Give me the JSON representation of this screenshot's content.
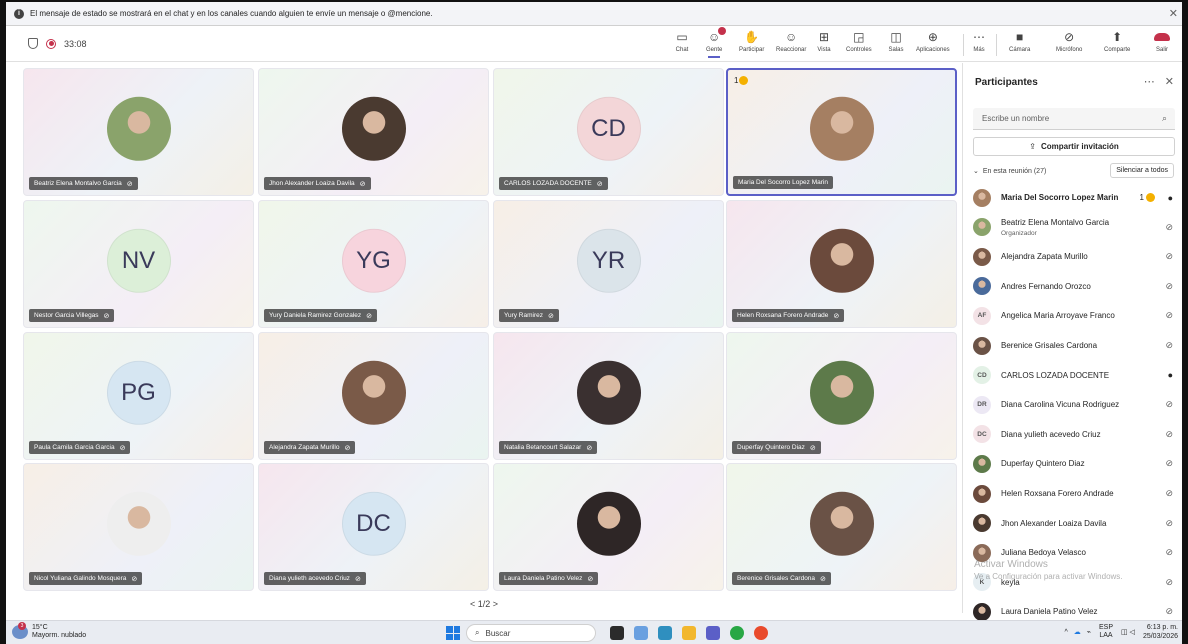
{
  "banner": {
    "text": "El mensaje de estado se mostrará en el chat y en los canales cuando alguien te envíe un mensaje o @mencione."
  },
  "meeting": {
    "elapsed": "33:08"
  },
  "toolbar": {
    "items": [
      {
        "label": "Chat",
        "icon": "chat-icon"
      },
      {
        "label": "Gente",
        "icon": "people-icon"
      },
      {
        "label": "Participar",
        "icon": "hand-icon"
      },
      {
        "label": "Reaccionar",
        "icon": "emoji-icon"
      },
      {
        "label": "Vista",
        "icon": "grid-icon"
      },
      {
        "label": "Controles",
        "icon": "controls-icon"
      },
      {
        "label": "Salas",
        "icon": "rooms-icon"
      },
      {
        "label": "Aplicaciones",
        "icon": "apps-icon"
      },
      {
        "label": "Más",
        "icon": "more-icon"
      },
      {
        "label": "Cámara",
        "icon": "camera-off-icon"
      },
      {
        "label": "Micrófono",
        "icon": "mic-off-icon"
      },
      {
        "label": "Comparte",
        "icon": "share-icon"
      },
      {
        "label": "Salir",
        "icon": "leave-icon"
      }
    ]
  },
  "grid": {
    "tiles": [
      {
        "name": "Beatriz Elena Montalvo Garcia",
        "initials": "",
        "photo": "#8aa36b"
      },
      {
        "name": "Jhon Alexander Loaiza Davila",
        "initials": "",
        "photo": "#4a3a30"
      },
      {
        "name": "CARLOS LOZADA DOCENTE",
        "initials": "CD",
        "photo": ""
      },
      {
        "name": "Maria Del Socorro Lopez Marin",
        "initials": "",
        "photo": "#a57f62",
        "hand": "1"
      },
      {
        "name": "Nestor Garcia Villegas",
        "initials": "NV",
        "photo": ""
      },
      {
        "name": "Yury Daniela Ramirez Gonzalez",
        "initials": "YG",
        "photo": ""
      },
      {
        "name": "Yury Ramirez",
        "initials": "YR",
        "photo": ""
      },
      {
        "name": "Helen Roxsana Forero Andrade",
        "initials": "",
        "photo": "#6b4a3c"
      },
      {
        "name": "Paula Camila Garcia Garcia",
        "initials": "PG",
        "photo": ""
      },
      {
        "name": "Alejandra Zapata Murillo",
        "initials": "",
        "photo": "#7a5a48"
      },
      {
        "name": "Natalia Betancourt Salazar",
        "initials": "",
        "photo": "#3a3030"
      },
      {
        "name": "Duperfay Quintero Diaz",
        "initials": "",
        "photo": "#5d7a4a"
      },
      {
        "name": "Nicol Yuliana Galindo Mosquera",
        "initials": "",
        "photo": "#eeeeee"
      },
      {
        "name": "Diana yulieth acevedo Criuz",
        "initials": "DC",
        "photo": ""
      },
      {
        "name": "Laura Daniela Patino Velez",
        "initials": "",
        "photo": "#2e2626"
      },
      {
        "name": "Berenice Grisales Cardona",
        "initials": "",
        "photo": "#6a5246"
      }
    ],
    "pager": "< 1/2 >"
  },
  "participants": {
    "title": "Participantes",
    "search_placeholder": "Escribe un nombre",
    "share_label": "Compartir invitación",
    "section_label": "En esta reunión (27)",
    "mute_all_label": "Silenciar a todos",
    "list": [
      {
        "name": "Maria Del Socorro Lopez Marin",
        "role": "",
        "initials": "",
        "photo": "#a57f62",
        "hand": "1",
        "mic": "on",
        "bold": true
      },
      {
        "name": "Beatriz Elena Montalvo Garcia",
        "role": "Organizador",
        "initials": "",
        "photo": "#8aa36b",
        "mic": "off"
      },
      {
        "name": "Alejandra Zapata Murillo",
        "role": "",
        "initials": "",
        "photo": "#7a5a48",
        "mic": "off"
      },
      {
        "name": "Andres Fernando Orozco",
        "role": "",
        "initials": "",
        "photo": "#4a6a9a",
        "mic": "off"
      },
      {
        "name": "Angelica Maria Arroyave Franco",
        "role": "",
        "initials": "AF",
        "photo": "",
        "mic": "off"
      },
      {
        "name": "Berenice Grisales Cardona",
        "role": "",
        "initials": "",
        "photo": "#6a5246",
        "mic": "off"
      },
      {
        "name": "CARLOS LOZADA DOCENTE",
        "role": "",
        "initials": "CD",
        "photo": "",
        "mic": "on"
      },
      {
        "name": "Diana Carolina Vicuna Rodriguez",
        "role": "",
        "initials": "DR",
        "photo": "",
        "mic": "off"
      },
      {
        "name": "Diana yulieth acevedo Criuz",
        "role": "",
        "initials": "DC",
        "photo": "",
        "mic": "off"
      },
      {
        "name": "Duperfay Quintero Diaz",
        "role": "",
        "initials": "",
        "photo": "#5d7a4a",
        "mic": "off"
      },
      {
        "name": "Helen Roxsana Forero Andrade",
        "role": "",
        "initials": "",
        "photo": "#6b4a3c",
        "mic": "off"
      },
      {
        "name": "Jhon Alexander Loaiza Davila",
        "role": "",
        "initials": "",
        "photo": "#4a3a30",
        "mic": "off"
      },
      {
        "name": "Juliana Bedoya Velasco",
        "role": "",
        "initials": "",
        "photo": "#8a6a58",
        "mic": "off"
      },
      {
        "name": "keyla",
        "role": "",
        "initials": "K",
        "photo": "",
        "mic": "off"
      },
      {
        "name": "Laura Daniela Patino Velez",
        "role": "",
        "initials": "",
        "photo": "#2e2626",
        "mic": "off"
      }
    ]
  },
  "watermark": {
    "line1": "Activar Windows",
    "line2": "Ve a Configuración para activar Windows."
  },
  "taskbar": {
    "temperature": "15°C",
    "weather": "Mayorm. nublado",
    "weather_badge": "3",
    "search_label": "Buscar",
    "lang_top": "ESP",
    "lang_bottom": "LAA",
    "time": "6:13 p. m.",
    "date": "25/03/2026"
  },
  "colors": {
    "accent": "#5b5fc7",
    "record": "#c4314b",
    "leave": "#c4314b",
    "hand": "#f4b000"
  }
}
